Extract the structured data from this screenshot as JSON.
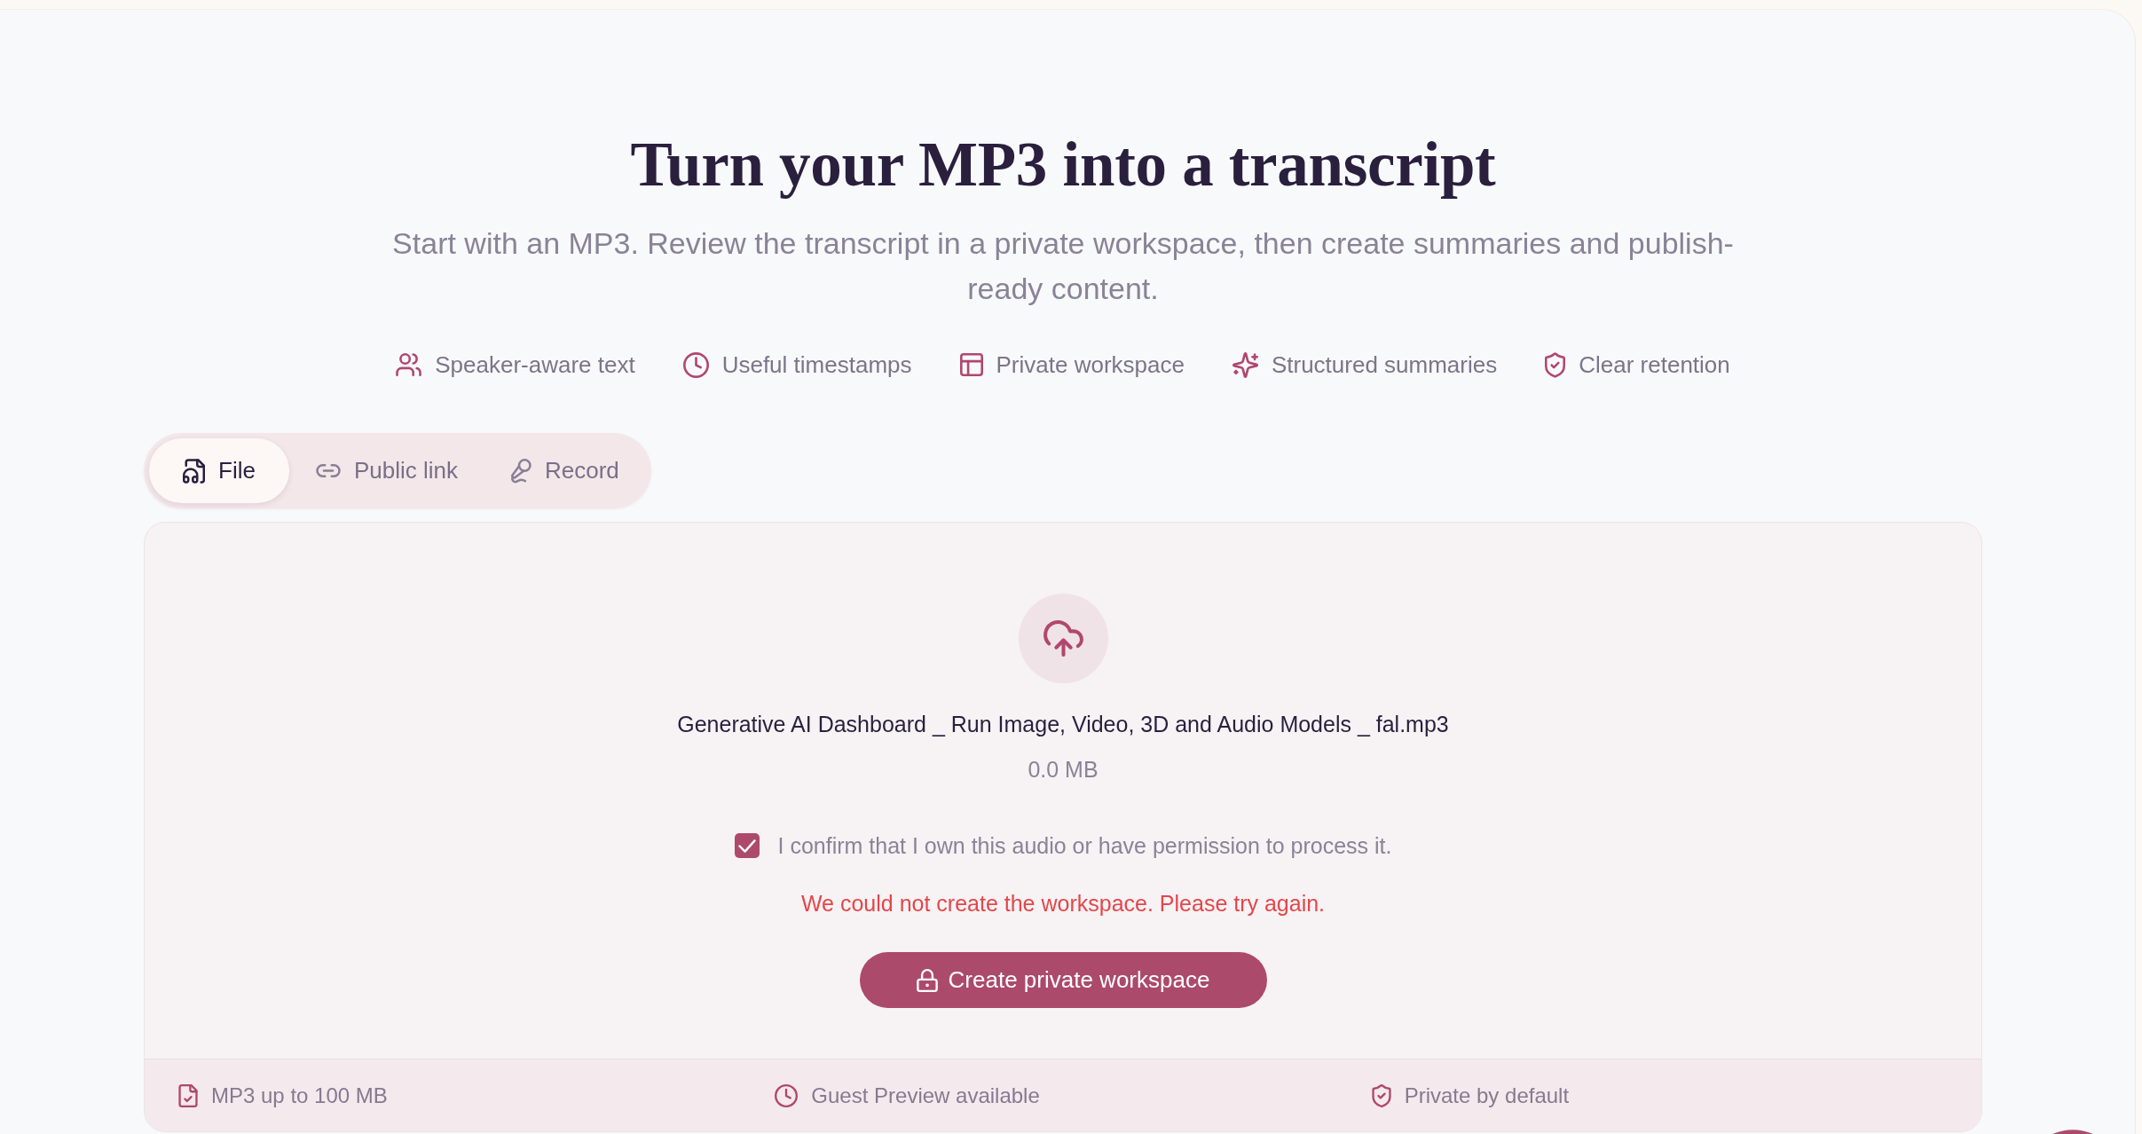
{
  "hero": {
    "title": "Turn your MP3 into a transcript",
    "subtitle": "Start with an MP3. Review the transcript in a private workspace, then create summaries and publish-ready content."
  },
  "features": [
    {
      "kind": "speakers",
      "label": "Speaker-aware text"
    },
    {
      "kind": "timestamps",
      "label": "Useful timestamps"
    },
    {
      "kind": "workspace",
      "label": "Private workspace"
    },
    {
      "kind": "summaries",
      "label": "Structured summaries"
    },
    {
      "kind": "retention",
      "label": "Clear retention"
    }
  ],
  "source_tabs": [
    {
      "kind": "file",
      "label": "File",
      "selected": true
    },
    {
      "kind": "link",
      "label": "Public link",
      "selected": false
    },
    {
      "kind": "record",
      "label": "Record",
      "selected": false
    }
  ],
  "upload": {
    "file_name": "Generative AI Dashboard _ Run Image, Video, 3D and Audio Models _ fal.mp3",
    "file_size": "0.0 MB",
    "consent": {
      "label": "I confirm that I own this audio or have permission to process it.",
      "checked": true
    },
    "error": "We could not create the workspace. Please try again.",
    "submit_button": "Create private workspace"
  },
  "footer_notes": [
    {
      "kind": "format",
      "label": "MP3 up to 100 MB"
    },
    {
      "kind": "preview",
      "label": "Guest Preview available"
    },
    {
      "kind": "privacy",
      "label": "Private by default"
    }
  ]
}
